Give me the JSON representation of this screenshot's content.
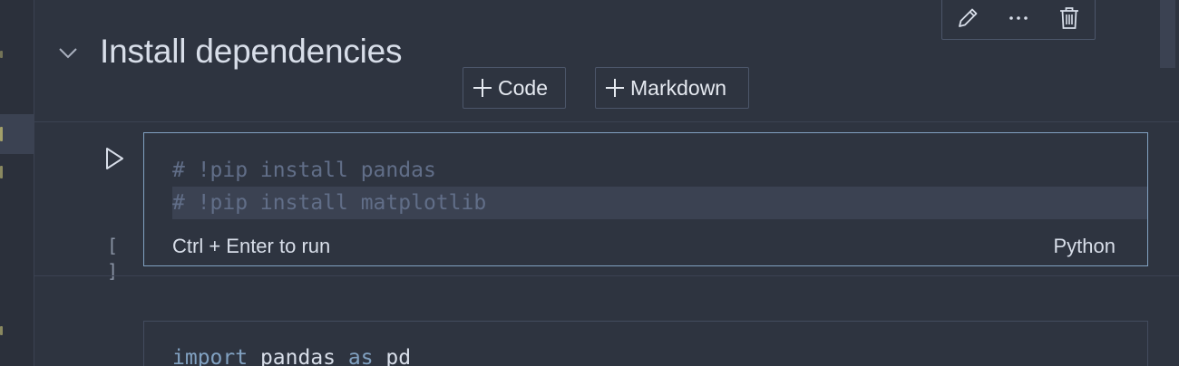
{
  "markdown_cell": {
    "heading": "Install dependencies",
    "collapse_icon": "chevron-down-icon"
  },
  "cell_toolbar": {
    "edit_icon": "pencil-icon",
    "more_icon": "more-horizontal-icon",
    "delete_icon": "trash-icon"
  },
  "add_cell": {
    "code_label": "Code",
    "markdown_label": "Markdown",
    "plus_icon": "plus-icon"
  },
  "code_cell": {
    "run_icon": "play-icon",
    "execution_count": "[ ]",
    "lines": [
      "# !pip install pandas",
      "# !pip install matplotlib"
    ],
    "hint": "Ctrl + Enter to run",
    "language": "Python"
  },
  "code_cell_2": {
    "line_tokens": [
      "import",
      " pandas ",
      "as",
      " pd"
    ]
  },
  "colors": {
    "background": "#2e3440",
    "focus_border": "#81a1c1",
    "comment": "#616e88",
    "keyword": "#81a1c1",
    "text": "#d8dee9"
  }
}
